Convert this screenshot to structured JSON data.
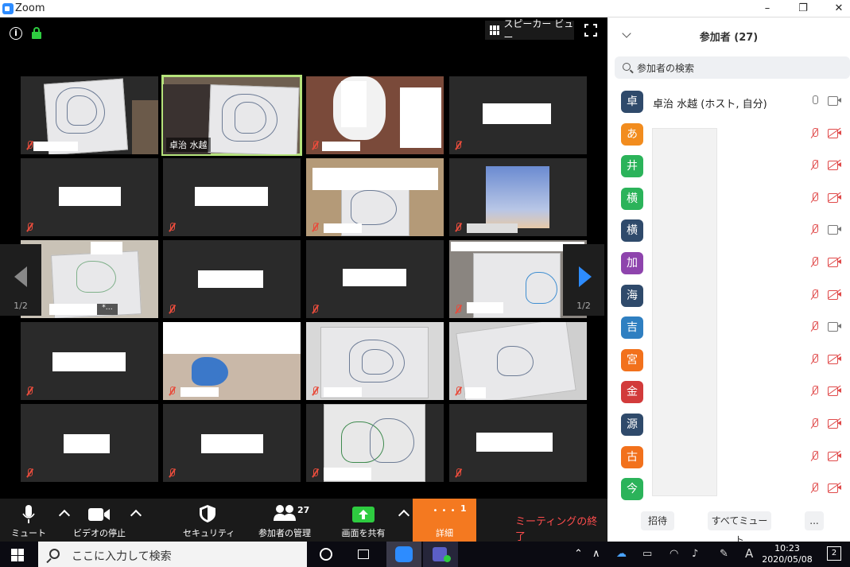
{
  "window": {
    "title": "Zoom",
    "minimize": "–",
    "maximize": "❐",
    "close": "✕"
  },
  "video": {
    "info_glyph": "i",
    "speaker_view_label": "スピーカー ビュー",
    "active_speaker_name": "卓治 水越",
    "page_indicator_left": "1/2",
    "page_indicator_right": "1/2"
  },
  "toolbar": {
    "mute_label": "ミュート",
    "video_label": "ビデオの停止",
    "security_label": "セキュリティ",
    "participants_label": "参加者の管理",
    "participants_count": "27",
    "share_label": "画面を共有",
    "details_label": "詳細",
    "details_badge": "1",
    "details_dots": "• • •",
    "end_label": "ミーティングの終了"
  },
  "panel": {
    "title": "参加者 (27)",
    "search_placeholder": "参加者の検索",
    "host_name": "卓治 水越 (ホスト, 自分)",
    "participants": [
      {
        "initial": "卓",
        "color": "#2f4a6b"
      },
      {
        "initial": "あ",
        "color": "#f28c1e"
      },
      {
        "initial": "井",
        "color": "#2bb35a"
      },
      {
        "initial": "横",
        "color": "#2bb35a"
      },
      {
        "initial": "横",
        "color": "#2f4a6b"
      },
      {
        "initial": "加",
        "color": "#8e44ad"
      },
      {
        "initial": "海",
        "color": "#2f4a6b"
      },
      {
        "initial": "吉",
        "color": "#2f7fc1"
      },
      {
        "initial": "宮",
        "color": "#f2711c"
      },
      {
        "initial": "金",
        "color": "#d23b3b"
      },
      {
        "initial": "源",
        "color": "#2f4a6b"
      },
      {
        "initial": "古",
        "color": "#f2711c"
      },
      {
        "initial": "今",
        "color": "#2bb35a"
      }
    ],
    "invite_label": "招待",
    "mute_all_label": "すべてミュート",
    "more_label": "..."
  },
  "taskbar": {
    "search_placeholder": "ここに入力して検索",
    "ime_label": "A",
    "time": "10:23",
    "date": "2020/05/08",
    "notification_count": "2"
  }
}
